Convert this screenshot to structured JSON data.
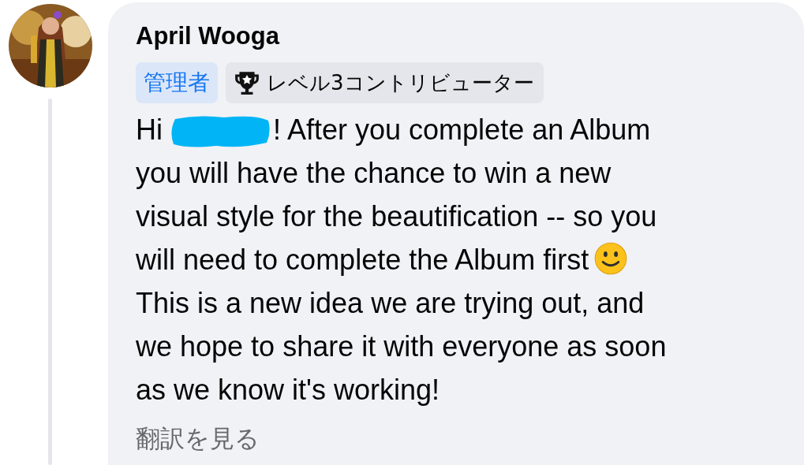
{
  "author": {
    "name": "April Wooga"
  },
  "badges": [
    {
      "kind": "role",
      "label": "管理者"
    },
    {
      "kind": "contributor",
      "label": "レベル3コントリビューター"
    }
  ],
  "message": {
    "lines": [
      {
        "kind": "greeting",
        "greeting": "Hi",
        "redacted": true,
        "text": "! After you complete an Album"
      },
      {
        "kind": "plain",
        "text": "you will have the chance to win a new"
      },
      {
        "kind": "plain",
        "text": "visual style for the beautification -- so you"
      },
      {
        "kind": "smiley",
        "text": "will need to complete the Album first"
      },
      {
        "kind": "plain",
        "text": "This is a new idea we are trying out, and"
      },
      {
        "kind": "plain",
        "text": "we hope to share it with everyone as soon"
      },
      {
        "kind": "plain",
        "text": "as we know it's working!"
      }
    ]
  },
  "translate_link": "翻訳を見る"
}
